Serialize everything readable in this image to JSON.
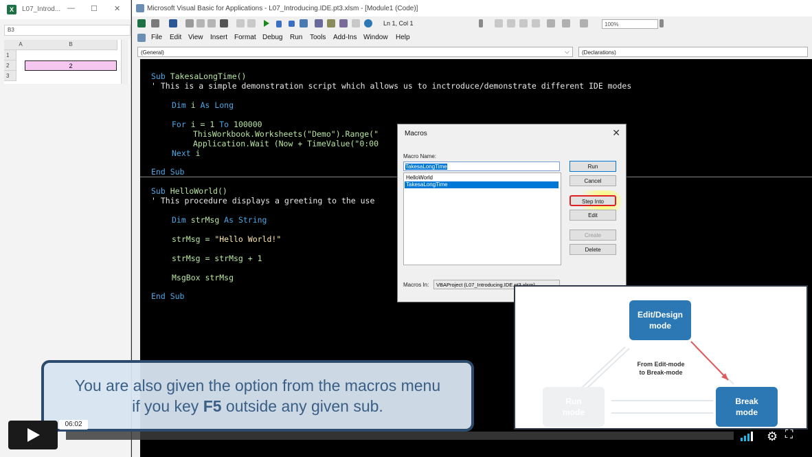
{
  "excel": {
    "title": "L07_Introd...",
    "min": "—",
    "max": "☐",
    "close": "✕",
    "namebox": "B3",
    "columns": [
      "A",
      "B"
    ],
    "rows": [
      "1",
      "2",
      "3"
    ],
    "cell_b2": "2"
  },
  "vba": {
    "title": "Microsoft Visual Basic for Applications - L07_Introducing.IDE.pt3.xlsm - [Module1 (Code)]",
    "position": "Ln 1, Col 1",
    "zoom": "100%",
    "menu": [
      "File",
      "Edit",
      "View",
      "Insert",
      "Format",
      "Debug",
      "Run",
      "Tools",
      "Add-Ins",
      "Window",
      "Help"
    ],
    "object_combo": "(General)",
    "proc_combo": "(Declarations)"
  },
  "code": {
    "l1_kw": "Sub ",
    "l1_tx": "TakesaLongTime()",
    "l2": "' This is a simple demonstration script which allows us to inctroduce/demonstrate different IDE modes",
    "l3_kw": "Dim ",
    "l3_tx": "i ",
    "l3_kw2": "As Long",
    "l4_kw": "For ",
    "l4_tx": "i = 1 ",
    "l4_kw2": "To ",
    "l4_tx2": "100000",
    "l5": "ThisWorkbook.Worksheets(\"Demo\").Range(\"",
    "l6": "Application.Wait (Now + TimeValue(\"0:00",
    "l7_kw": "Next ",
    "l7_tx": "i",
    "l8": "End Sub",
    "l9_kw": "Sub ",
    "l9_tx": "HelloWorld()",
    "l10": "' This procedure displays a greeting to the use",
    "l11_kw": "Dim ",
    "l11_tx": "strMsg ",
    "l11_kw2": "As String",
    "l12_tx": "strMsg = ",
    "l12_st": "\"Hello World!\"",
    "l13": "strMsg = strMsg + 1",
    "l14": "MsgBox strMsg",
    "l15": "End Sub"
  },
  "dialog": {
    "title": "Macros",
    "close": "✕",
    "name_label": "Macro Name:",
    "name_value": "TakesaLongTime",
    "items": [
      "HelloWorld",
      "TakesaLongTime"
    ],
    "buttons": {
      "run": "Run",
      "cancel": "Cancel",
      "step_into": "Step Into",
      "edit": "Edit",
      "create": "Create",
      "delete": "Delete"
    },
    "macros_in_label": "Macros In:",
    "macros_in_value": "VBAProject (L07_Introducing.IDE.pt3.xlsm)"
  },
  "caption": {
    "line1": "You are also given the option from the macros menu",
    "line2_pre": "if you key ",
    "line2_key": "F5",
    "line2_post": " outside any given sub."
  },
  "diagram": {
    "edit_mode": "Edit/Design",
    "edit_mode2": "mode",
    "run_mode": "Run",
    "run_mode2": "mode",
    "break_mode": "Break",
    "break_mode2": "mode",
    "transition1": "From Edit-mode",
    "transition2": "to Break-mode",
    "colors": {
      "box": "#2b78b4",
      "arrow": "#e05a5a"
    }
  },
  "player": {
    "time": "06:02",
    "progress": 0.0
  }
}
